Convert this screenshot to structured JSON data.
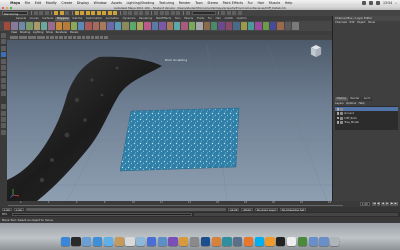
{
  "mac_menubar": {
    "apple": "",
    "items": [
      "Maya",
      "File",
      "Edit",
      "Modify",
      "Create",
      "Display",
      "Window",
      "Assets",
      "Lighting/Shading",
      "Texturing",
      "Render",
      "Toon",
      "Stereo",
      "Paint Effects",
      "Fur",
      "Hair",
      "Muscle",
      "Help"
    ],
    "clock": "13:54"
  },
  "window": {
    "title": "Autodesk Maya 2011 x64 – Student Version: /Users/student/Documents/maya/projects/Environment/scenes/Cliff_Detail.mb"
  },
  "status_line": {
    "mode": "Rendering"
  },
  "shelf_tabs": [
    "General",
    "Curves",
    "Surfaces",
    "Polygons",
    "Subdivs",
    "Deformation",
    "Animation",
    "Dynamics",
    "Rendering",
    "PaintEffects",
    "Toon",
    "Muscle",
    "Fluids",
    "Fur",
    "Hair",
    "nCloth",
    "Custom"
  ],
  "shelf_active": "Polygons",
  "viewport": {
    "menu": [
      "View",
      "Shading",
      "Lighting",
      "Show",
      "Renderer",
      "Panels"
    ],
    "camera_label": "Rock Sculpting",
    "axis": {
      "x": "x",
      "y": "y",
      "z": "z"
    },
    "colors": {
      "rock": "#2a2a2a",
      "plane": "#2f7fa8",
      "plane_specks": "#bfe4f2"
    }
  },
  "channel_box": {
    "title": "Channel Box / Layer Editor",
    "menu": [
      "Channels",
      "Edit",
      "Object",
      "Show"
    ],
    "tabs": [
      "Display",
      "Render",
      "Anim"
    ],
    "layer_menu": [
      "Layers",
      "Options",
      "Help"
    ],
    "layers": [
      {
        "name": "",
        "visible": "V",
        "selected": true
      },
      {
        "name": "Ground",
        "visible": "V",
        "selected": false
      },
      {
        "name": "Cliff_Rock",
        "visible": "V",
        "selected": false
      },
      {
        "name": "Tree_Model",
        "visible": "V",
        "selected": false
      }
    ]
  },
  "time_slider": {
    "ticks": [
      "2",
      "4",
      "6",
      "8",
      "10",
      "12",
      "14",
      "16",
      "18",
      "20",
      "22",
      "24"
    ],
    "current": "1.00",
    "playback": [
      "|◀",
      "◀|",
      "◀",
      "▶",
      "|▶",
      "▶|"
    ]
  },
  "range_slider": {
    "start": "1.00",
    "inner_start": "1.00",
    "inner_end": "24.00",
    "end": "48.00",
    "anim_layer": "No Anim Layer",
    "char_set": "No Character Set"
  },
  "command_line": {
    "mode": "MEL"
  },
  "help_line": {
    "text": "Move Tool: Select an object to move."
  },
  "dock": {
    "apps": [
      "finder",
      "dashboard",
      "mail",
      "safari",
      "ichat",
      "address-book",
      "ical",
      "preview",
      "itunes",
      "iphoto",
      "imovie",
      "garageband",
      "system-preferences",
      "photoshop",
      "illustrator",
      "maya",
      "mudbox",
      "firefox",
      "skype",
      "vlc",
      "terminal",
      "textedit",
      "activity-monitor",
      "downloads",
      "documents",
      "trash"
    ],
    "colors": [
      "#3a86d8",
      "#2a2a2a",
      "#6aa0d8",
      "#3f8fd8",
      "#5fb0e8",
      "#c69a5a",
      "#d9d9d9",
      "#8fb7d8",
      "#4a6ed8",
      "#5a8fc8",
      "#7a4fb8",
      "#d89a3a",
      "#8a8a8a",
      "#1d4f8f",
      "#d7813a",
      "#2f8f9f",
      "#5a6f8a",
      "#e8772e",
      "#00aff0",
      "#f09a2a",
      "#222222",
      "#eeeeee",
      "#4a8a3a",
      "#6a8fc8",
      "#6a8fc8",
      "#b0b5ba"
    ]
  }
}
